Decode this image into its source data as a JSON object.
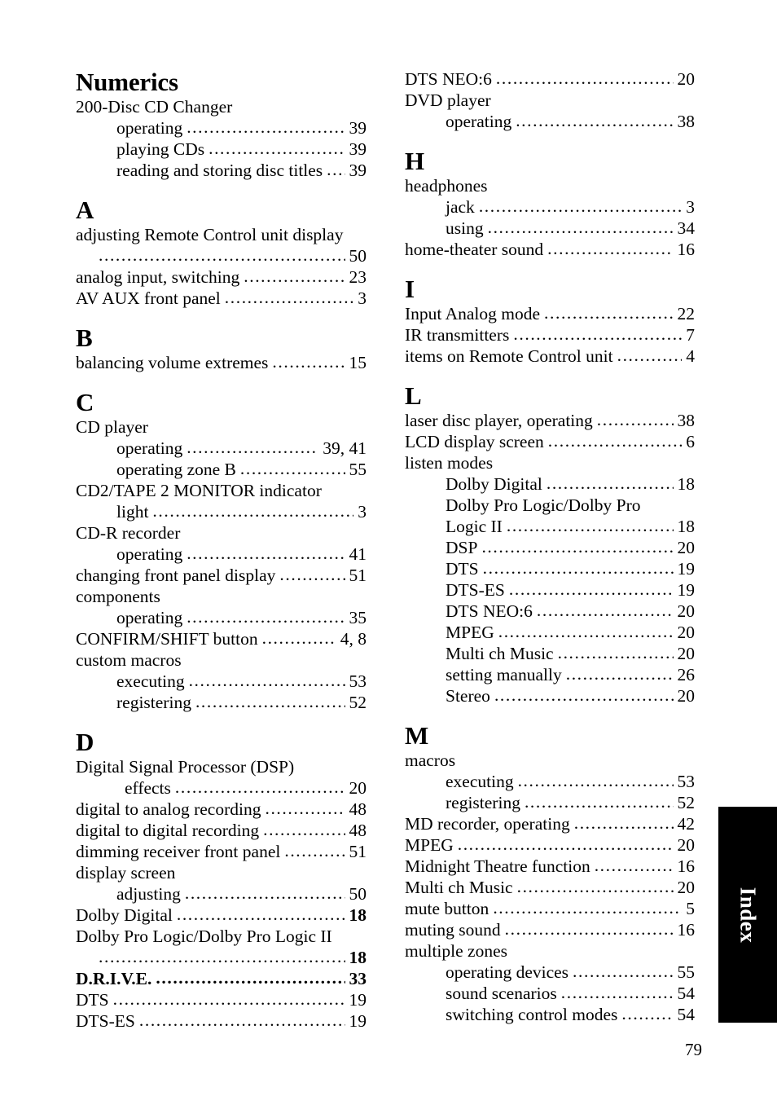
{
  "page": {
    "folio": "79",
    "tab_label": "Index"
  },
  "left_column": [
    {
      "kind": "heading",
      "text": "Numerics"
    },
    {
      "kind": "plain",
      "text": "200-Disc CD Changer"
    },
    {
      "kind": "sub",
      "label": "operating",
      "page": "39"
    },
    {
      "kind": "sub",
      "label": "playing CDs",
      "page": "39"
    },
    {
      "kind": "sub",
      "label": "reading and storing disc titles",
      "page": "39"
    },
    {
      "kind": "heading",
      "text": "A"
    },
    {
      "kind": "plain",
      "text": "adjusting Remote Control unit display"
    },
    {
      "kind": "cont",
      "label": "",
      "page": "50"
    },
    {
      "kind": "entry",
      "label": "analog input, switching",
      "page": "23"
    },
    {
      "kind": "entry",
      "label": "AV AUX front panel",
      "page": "3"
    },
    {
      "kind": "heading",
      "text": "B"
    },
    {
      "kind": "entry",
      "label": "balancing volume extremes",
      "page": "15"
    },
    {
      "kind": "heading",
      "text": "C"
    },
    {
      "kind": "plain",
      "text": "CD player"
    },
    {
      "kind": "sub",
      "label": "operating",
      "page": "39, 41"
    },
    {
      "kind": "sub",
      "label": "operating zone B",
      "page": "55"
    },
    {
      "kind": "plain",
      "text": "CD2/TAPE 2 MONITOR indicator"
    },
    {
      "kind": "sub",
      "label": "light",
      "page": "3"
    },
    {
      "kind": "plain",
      "text": "CD-R recorder"
    },
    {
      "kind": "sub",
      "label": "operating",
      "page": "41"
    },
    {
      "kind": "entry",
      "label": "changing front panel display",
      "page": "51"
    },
    {
      "kind": "plain",
      "text": "components"
    },
    {
      "kind": "sub",
      "label": "operating",
      "page": "35"
    },
    {
      "kind": "entry",
      "label": "CONFIRM/SHIFT button",
      "page": "4, 8"
    },
    {
      "kind": "plain",
      "text": "custom macros"
    },
    {
      "kind": "sub",
      "label": "executing",
      "page": "53"
    },
    {
      "kind": "sub",
      "label": "registering",
      "page": "52"
    },
    {
      "kind": "heading",
      "text": "D"
    },
    {
      "kind": "plain",
      "text": "Digital Signal Processor (DSP)"
    },
    {
      "kind": "sub2",
      "label": "effects",
      "page": "20"
    },
    {
      "kind": "entry",
      "label": "digital to analog recording",
      "page": "48"
    },
    {
      "kind": "entry",
      "label": "digital to digital recording",
      "page": "48"
    },
    {
      "kind": "entry",
      "label": "dimming receiver front panel",
      "page": "51"
    },
    {
      "kind": "plain",
      "text": "display screen"
    },
    {
      "kind": "sub",
      "label": "adjusting",
      "page": "50"
    },
    {
      "kind": "entry",
      "label": "Dolby Digital",
      "page": "18",
      "page_bold": true
    },
    {
      "kind": "plain",
      "text": "Dolby Pro Logic/Dolby Pro Logic II"
    },
    {
      "kind": "cont",
      "label": "",
      "page": "18",
      "page_bold": true
    },
    {
      "kind": "entry",
      "label": "D.R.I.V.E.",
      "page": "33",
      "bold": true
    },
    {
      "kind": "entry",
      "label": "DTS",
      "page": "19"
    },
    {
      "kind": "entry",
      "label": "DTS-ES",
      "page": "19"
    }
  ],
  "right_column": [
    {
      "kind": "entry",
      "label": "DTS NEO:6",
      "page": "20"
    },
    {
      "kind": "plain",
      "text": "DVD player"
    },
    {
      "kind": "sub",
      "label": "operating",
      "page": "38"
    },
    {
      "kind": "heading",
      "text": "H"
    },
    {
      "kind": "plain",
      "text": "headphones"
    },
    {
      "kind": "sub",
      "label": "jack",
      "page": "3"
    },
    {
      "kind": "sub",
      "label": "using",
      "page": "34"
    },
    {
      "kind": "entry",
      "label": "home-theater sound",
      "page": "16"
    },
    {
      "kind": "heading",
      "text": "I"
    },
    {
      "kind": "entry",
      "label": "Input Analog mode",
      "page": "22"
    },
    {
      "kind": "entry",
      "label": "IR transmitters",
      "page": "7"
    },
    {
      "kind": "entry",
      "label": "items on Remote Control unit",
      "page": "4"
    },
    {
      "kind": "heading",
      "text": "L"
    },
    {
      "kind": "entry",
      "label": "laser disc player, operating",
      "page": "38"
    },
    {
      "kind": "entry",
      "label": "LCD display screen",
      "page": "6"
    },
    {
      "kind": "plain",
      "text": "listen modes"
    },
    {
      "kind": "sub",
      "label": "Dolby Digital",
      "page": "18"
    },
    {
      "kind": "sub-plain",
      "text": "Dolby Pro Logic/Dolby Pro"
    },
    {
      "kind": "sub",
      "label": "Logic II",
      "page": "18"
    },
    {
      "kind": "sub",
      "label": "DSP",
      "page": "20"
    },
    {
      "kind": "sub",
      "label": "DTS",
      "page": "19"
    },
    {
      "kind": "sub",
      "label": "DTS-ES",
      "page": "19"
    },
    {
      "kind": "sub",
      "label": "DTS NEO:6",
      "page": "20"
    },
    {
      "kind": "sub",
      "label": "MPEG",
      "page": "20"
    },
    {
      "kind": "sub",
      "label": "Multi ch Music",
      "page": "20"
    },
    {
      "kind": "sub",
      "label": "setting manually",
      "page": "26"
    },
    {
      "kind": "sub",
      "label": "Stereo",
      "page": "20"
    },
    {
      "kind": "heading",
      "text": "M"
    },
    {
      "kind": "plain",
      "text": "macros"
    },
    {
      "kind": "sub",
      "label": "executing",
      "page": "53"
    },
    {
      "kind": "sub",
      "label": "registering",
      "page": "52"
    },
    {
      "kind": "entry",
      "label": "MD recorder, operating",
      "page": "42"
    },
    {
      "kind": "entry",
      "label": "MPEG",
      "page": "20"
    },
    {
      "kind": "entry",
      "label": "Midnight Theatre function",
      "page": "16"
    },
    {
      "kind": "entry",
      "label": "Multi ch Music",
      "page": "20"
    },
    {
      "kind": "entry",
      "label": "mute button",
      "page": "5"
    },
    {
      "kind": "entry",
      "label": "muting sound",
      "page": "16"
    },
    {
      "kind": "plain",
      "text": "multiple zones"
    },
    {
      "kind": "sub",
      "label": "operating devices",
      "page": "55"
    },
    {
      "kind": "sub",
      "label": "sound scenarios",
      "page": "54"
    },
    {
      "kind": "sub",
      "label": "switching control modes",
      "page": "54"
    }
  ]
}
